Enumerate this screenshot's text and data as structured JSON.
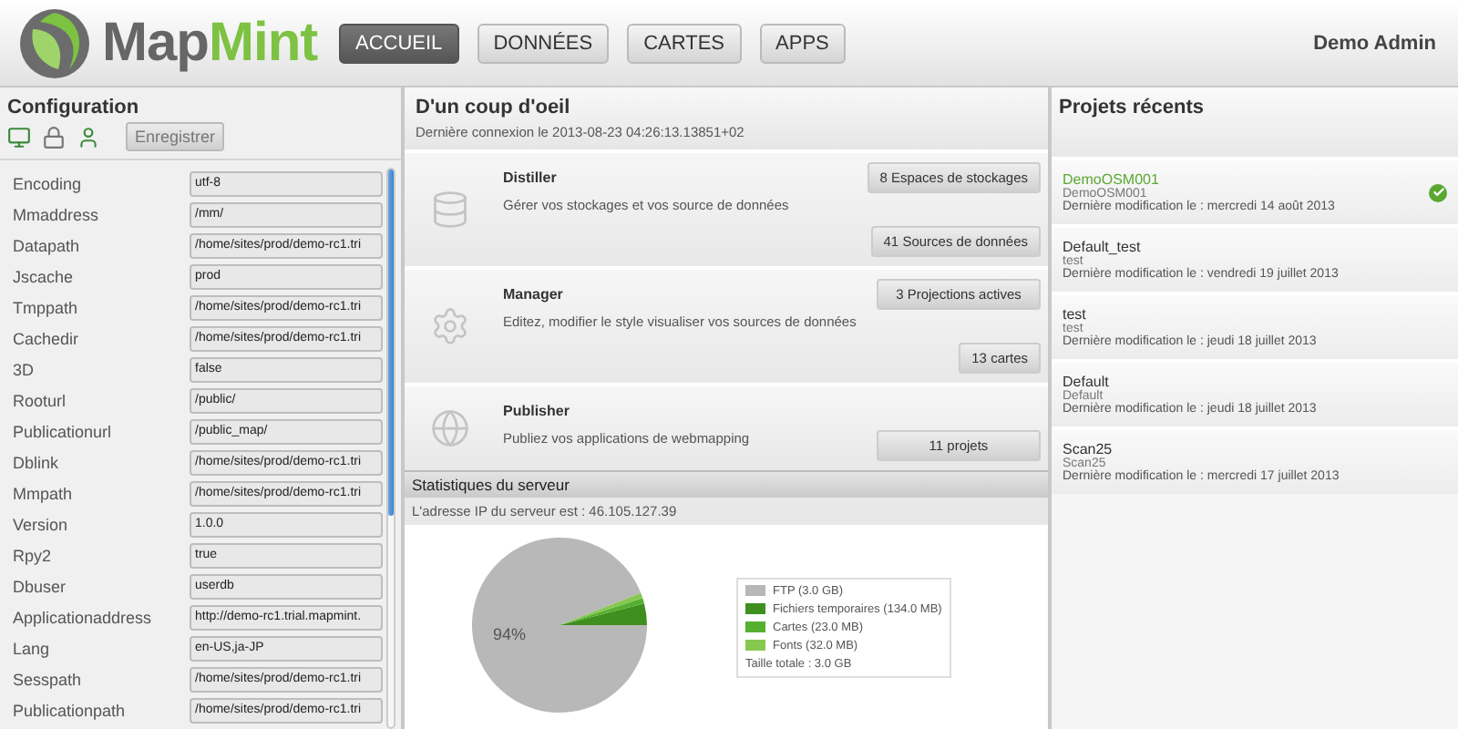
{
  "logo": {
    "parts": [
      "Map",
      "Mint"
    ]
  },
  "nav": [
    {
      "label": "ACCUEIL",
      "selected": true
    },
    {
      "label": "DONNÉES",
      "selected": false
    },
    {
      "label": "CARTES",
      "selected": false
    },
    {
      "label": "APPS",
      "selected": false
    }
  ],
  "user": "Demo Admin",
  "configuration": {
    "title": "Configuration",
    "save_button": "Enregistrer",
    "fields": [
      {
        "label": "Encoding",
        "value": "utf-8"
      },
      {
        "label": "Mmaddress",
        "value": "/mm/"
      },
      {
        "label": "Datapath",
        "value": "/home/sites/prod/demo-rc1.tri"
      },
      {
        "label": "Jscache",
        "value": "prod"
      },
      {
        "label": "Tmppath",
        "value": "/home/sites/prod/demo-rc1.tri"
      },
      {
        "label": "Cachedir",
        "value": "/home/sites/prod/demo-rc1.tri"
      },
      {
        "label": "3D",
        "value": "false"
      },
      {
        "label": "Rooturl",
        "value": "/public/"
      },
      {
        "label": "Publicationurl",
        "value": "/public_map/"
      },
      {
        "label": "Dblink",
        "value": "/home/sites/prod/demo-rc1.tri"
      },
      {
        "label": "Mmpath",
        "value": "/home/sites/prod/demo-rc1.tri"
      },
      {
        "label": "Version",
        "value": "1.0.0"
      },
      {
        "label": "Rpy2",
        "value": "true"
      },
      {
        "label": "Dbuser",
        "value": "userdb"
      },
      {
        "label": "Applicationaddress",
        "value": "http://demo-rc1.trial.mapmint."
      },
      {
        "label": "Lang",
        "value": "en-US,ja-JP"
      },
      {
        "label": "Sesspath",
        "value": "/home/sites/prod/demo-rc1.tri"
      },
      {
        "label": "Publicationpath",
        "value": "/home/sites/prod/demo-rc1.tri"
      }
    ]
  },
  "overview": {
    "title": "D'un coup d'oeil",
    "last_login": "Dernière connexion le 2013-08-23 04:26:13.13851+02",
    "modules": [
      {
        "kind": "database",
        "name": "Distiller",
        "description": "Gérer vos stockages et vos source de données",
        "buttons": [
          "8 Espaces de stockages",
          "41 Sources de données"
        ]
      },
      {
        "kind": "gear",
        "name": "Manager",
        "description": "Editez, modifier le style visualiser vos sources de données",
        "buttons": [
          "3 Projections actives",
          "13 cartes"
        ]
      },
      {
        "kind": "globe",
        "name": "Publisher",
        "description": "Publiez vos applications de webmapping",
        "buttons": [
          "11 projets"
        ]
      }
    ]
  },
  "server_stats": {
    "title": "Statistiques du serveur",
    "ip": "L'adresse IP du serveur est : 46.105.127.39",
    "total": "Taille totale : 3.0 GB",
    "chart_data": {
      "type": "pie",
      "categories": [
        "FTP (3.0 GB)",
        "Fichiers temporaires (134.0 MB)",
        "Cartes (23.0 MB)",
        "Fonts (32.0 MB)"
      ],
      "values": [
        94,
        4,
        1,
        1
      ],
      "colors": [
        "#b8b8b8",
        "#3f8f1f",
        "#55b030",
        "#86c850"
      ],
      "value_labels": [
        "94%",
        null,
        null,
        null
      ]
    }
  },
  "recent_projects": {
    "title": "Projets récents",
    "items": [
      {
        "name": "DemoOSM001",
        "subtitle": "DemoOSM001",
        "date": "Dernière modification le : mercredi 14 août 2013",
        "selected": true
      },
      {
        "name": "Default_test",
        "subtitle": "test",
        "date": "Dernière modification le : vendredi 19 juillet 2013",
        "selected": false
      },
      {
        "name": "test",
        "subtitle": "test",
        "date": "Dernière modification le : jeudi 18 juillet 2013",
        "selected": false
      },
      {
        "name": "Default",
        "subtitle": "Default",
        "date": "Dernière modification le : jeudi 18 juillet 2013",
        "selected": false
      },
      {
        "name": "Scan25",
        "subtitle": "Scan25",
        "date": "Dernière modification le : mercredi 17 juillet 2013",
        "selected": false
      }
    ]
  }
}
